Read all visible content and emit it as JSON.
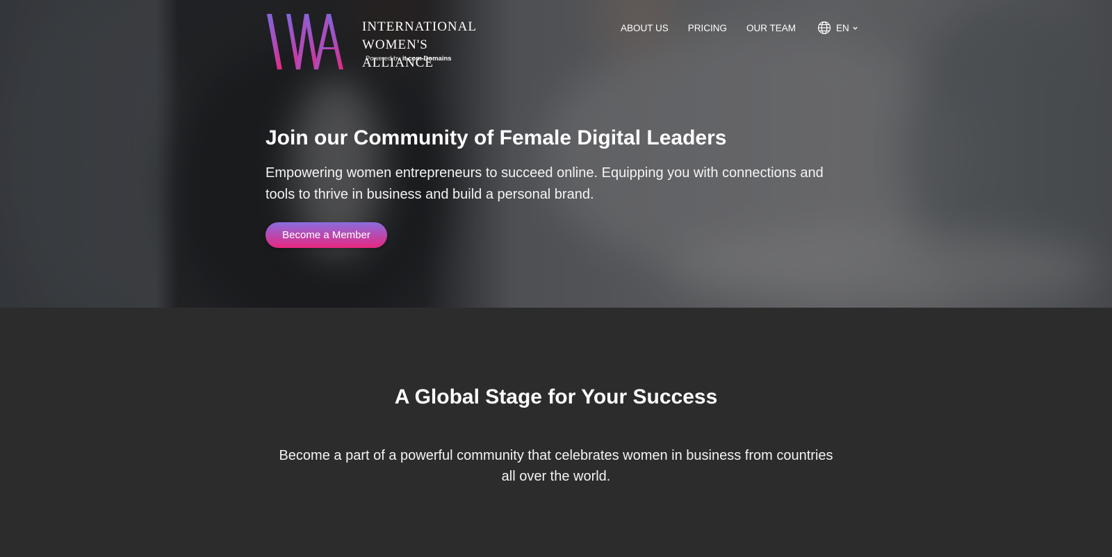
{
  "logo": {
    "line1": "INTERNATIONAL",
    "line2": "WOMEN'S ALLIANCE",
    "powered_prefix": "Powered by",
    "powered_brand": "it.com Domains"
  },
  "nav": {
    "items": [
      {
        "label": "ABOUT US"
      },
      {
        "label": "PRICING"
      },
      {
        "label": "OUR TEAM"
      }
    ],
    "language": "EN"
  },
  "hero": {
    "title": "Join our Community of Female Digital Leaders",
    "subtitle": "Empowering women entrepreneurs to succeed online. Equipping you with connections and tools to thrive in business and build a personal brand.",
    "cta_label": "Become a Member"
  },
  "section": {
    "title": "A Global Stage for Your Success",
    "body": "Become a part of a powerful community that celebrates women in business from countries all over the world."
  },
  "icons": {
    "globe": "globe-icon",
    "chevron": "chevron-down-icon"
  },
  "colors": {
    "accent_start": "#8a6dde",
    "accent_end": "#e8277f",
    "section_bg": "#2c2c2c"
  }
}
